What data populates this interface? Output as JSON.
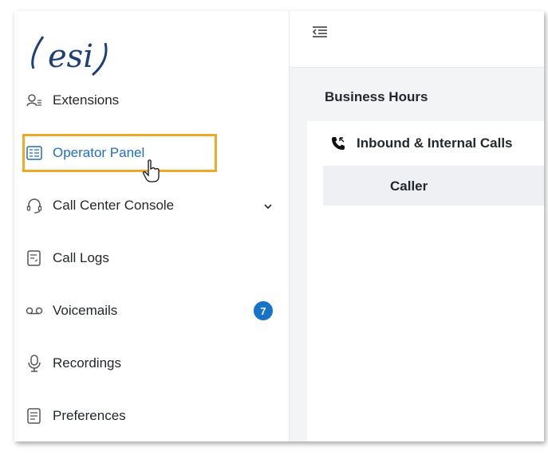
{
  "brand": {
    "logo_text": "esi"
  },
  "sidebar": {
    "items": [
      {
        "label": "Extensions",
        "icon": "extensions-icon"
      },
      {
        "label": "Operator Panel",
        "icon": "operator-panel-icon",
        "active": true
      },
      {
        "label": "Call Center Console",
        "icon": "headset-icon",
        "has_submenu": true
      },
      {
        "label": "Call Logs",
        "icon": "call-logs-icon"
      },
      {
        "label": "Voicemails",
        "icon": "voicemail-icon",
        "badge": "7"
      },
      {
        "label": "Recordings",
        "icon": "microphone-icon"
      },
      {
        "label": "Preferences",
        "icon": "preferences-icon"
      }
    ]
  },
  "topbar": {
    "menu_icon": "collapse-menu-icon"
  },
  "main": {
    "section_title": "Business Hours",
    "card": {
      "title": "Inbound & Internal Calls",
      "icon": "phone-icon",
      "table_headers": [
        "Caller"
      ]
    }
  },
  "colors": {
    "accent": "#1f6fbf",
    "highlight": "#f0a826",
    "badge": "#1673c7"
  }
}
